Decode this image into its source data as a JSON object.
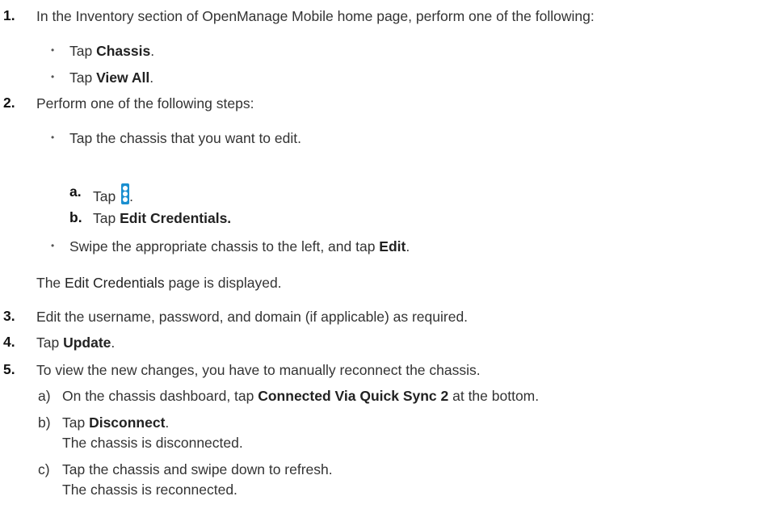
{
  "steps": {
    "s1": {
      "num": "1.",
      "text": "In the Inventory section of OpenManage Mobile home page, perform one of the following:"
    },
    "s1_opt1": {
      "pre": "Tap ",
      "bold": "Chassis",
      "post": "."
    },
    "s1_opt2": {
      "pre": "Tap ",
      "bold": "View All",
      "post": "."
    },
    "s2": {
      "num": "2.",
      "text": "Perform one of the following steps:"
    },
    "s2_opt1": {
      "text": "Tap the chassis that you want to edit."
    },
    "s2_sub_a": {
      "label": "a.",
      "pre": "Tap ",
      "post": "."
    },
    "s2_sub_b": {
      "label": "b.",
      "pre": "Tap ",
      "bold": "Edit Credentials."
    },
    "s2_opt2": {
      "pre": "Swipe the appropriate chassis to the left, and tap ",
      "bold": "Edit",
      "post": "."
    },
    "s2_result": {
      "pre": "The ",
      "bold": "Edit Credentials",
      "post": " page is displayed."
    },
    "s3": {
      "num": "3.",
      "text": "Edit the username, password, and domain (if applicable) as required."
    },
    "s4": {
      "num": "4.",
      "pre": "Tap ",
      "bold": "Update",
      "post": "."
    },
    "s5": {
      "num": "5.",
      "text": "To view the new changes, you have to manually reconnect the chassis."
    },
    "s5_a": {
      "label": "a)",
      "pre": "On the chassis dashboard, tap ",
      "bold": "Connected Via Quick Sync 2",
      "post": " at the bottom."
    },
    "s5_b": {
      "label": "b)",
      "pre": "Tap ",
      "bold": "Disconnect",
      "post": ".",
      "result": "The chassis is disconnected."
    },
    "s5_c": {
      "label": "c)",
      "text": "Tap the chassis and swipe down to refresh.",
      "result": "The chassis is reconnected."
    }
  },
  "bullet_char": "•",
  "icon": {
    "name": "more-vertical-icon",
    "color": "#1a8fd0"
  }
}
